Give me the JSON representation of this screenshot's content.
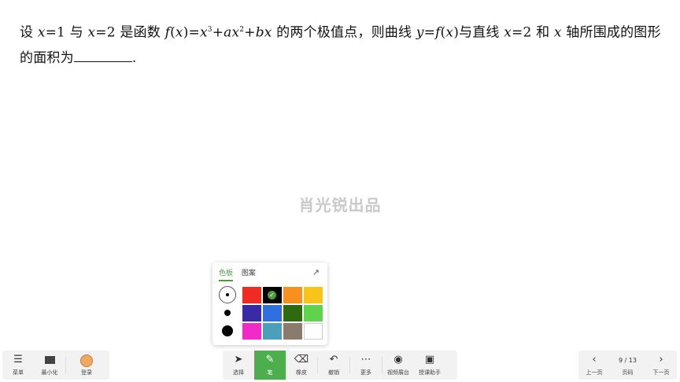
{
  "problem": {
    "t1": "设 ",
    "m1": "x",
    "t2": "=1 与 ",
    "m2": "x",
    "t3": "=2 是函数 ",
    "m3": "f",
    "t4": "(",
    "m4": "x",
    "t5": ")=",
    "m5": "x",
    "sup1": "3",
    "t6": "+",
    "m6": "ax",
    "sup2": "2",
    "t7": "+",
    "m7": "bx",
    "t8": " 的两个极值点，则曲线 ",
    "m8": "y",
    "t9": "=",
    "m9": "f",
    "t10": "(",
    "m10": "x",
    "t11": ")与直线 ",
    "m11": "x",
    "t12": "=2 和 ",
    "m12": "x",
    "t13": " 轴所围成的图形的面积为",
    "t14": "."
  },
  "watermark": "肖光锐出品",
  "palette": {
    "tabs": [
      "色板",
      "图案"
    ],
    "active_tab": "色板",
    "expand_icon": "expand-arrow-icon",
    "colors": [
      "#ef2b22",
      "#000000",
      "#f7901e",
      "#f9c41a",
      "#3a2aa8",
      "#2f6fe0",
      "#2e6b10",
      "#5fd34b",
      "#f02bc7",
      "#4aa0b8",
      "#8a7b6a",
      "#ffffff"
    ],
    "selected_color": "#000000"
  },
  "toolbar_left": {
    "menu_label": "菜单",
    "minimize_label": "最小化",
    "login_label": "登录"
  },
  "toolbar_mid": {
    "select_label": "选择",
    "pen_label": "笔",
    "eraser_label": "橡皮",
    "undo_label": "撤销",
    "more_label": "更多",
    "video_label": "视频展台",
    "assistant_label": "授课助手"
  },
  "toolbar_right": {
    "prev_label": "上一页",
    "page_indicator": "9 / 13",
    "page_label": "页码",
    "next_label": "下一页"
  }
}
